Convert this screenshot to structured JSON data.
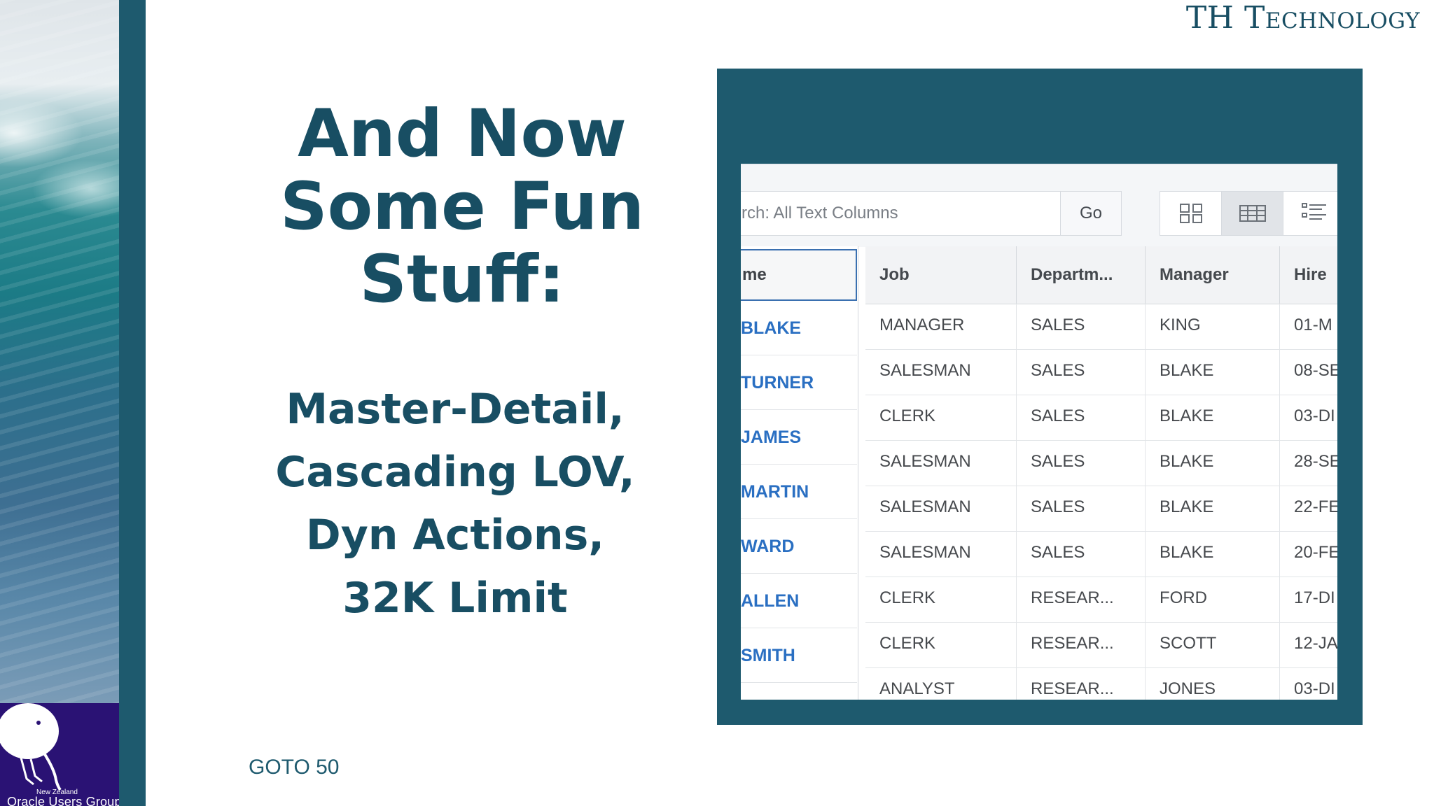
{
  "brand": "TH Technology",
  "slide": {
    "title_lines": [
      "And Now",
      "Some Fun",
      "Stuff:"
    ],
    "subtitle_lines": [
      "Master-Detail,",
      "Cascading LOV,",
      "Dyn Actions,",
      "32K Limit"
    ],
    "footer": "GOTO 50"
  },
  "logo": {
    "small_text": "New Zealand",
    "text": "Oracle Users Group"
  },
  "report": {
    "search_placeholder": "rch: All Text Columns",
    "go_label": "Go",
    "view_icons": [
      "icon-view-icon",
      "grid-view-icon",
      "detail-view-icon"
    ],
    "name_header": "me",
    "headers": [
      "Job",
      "Departm...",
      "Manager",
      "Hire"
    ],
    "names": [
      "BLAKE",
      "TURNER",
      "JAMES",
      "MARTIN",
      "WARD",
      "ALLEN",
      "SMITH"
    ],
    "rows": [
      [
        "MANAGER",
        "SALES",
        "KING",
        "01-M"
      ],
      [
        "SALESMAN",
        "SALES",
        "BLAKE",
        "08-SE"
      ],
      [
        "CLERK",
        "SALES",
        "BLAKE",
        "03-DI"
      ],
      [
        "SALESMAN",
        "SALES",
        "BLAKE",
        "28-SE"
      ],
      [
        "SALESMAN",
        "SALES",
        "BLAKE",
        "22-FE"
      ],
      [
        "SALESMAN",
        "SALES",
        "BLAKE",
        "20-FE"
      ],
      [
        "CLERK",
        "RESEAR...",
        "FORD",
        "17-DI"
      ],
      [
        "CLERK",
        "RESEAR...",
        "SCOTT",
        "12-JA"
      ],
      [
        "ANALYST",
        "RESEAR...",
        "JONES",
        "03-DI"
      ]
    ]
  },
  "colors": {
    "primary": "#1e5a6e",
    "title": "#184e63",
    "link": "#2a6fc2",
    "logo_bg": "#2a1274"
  }
}
